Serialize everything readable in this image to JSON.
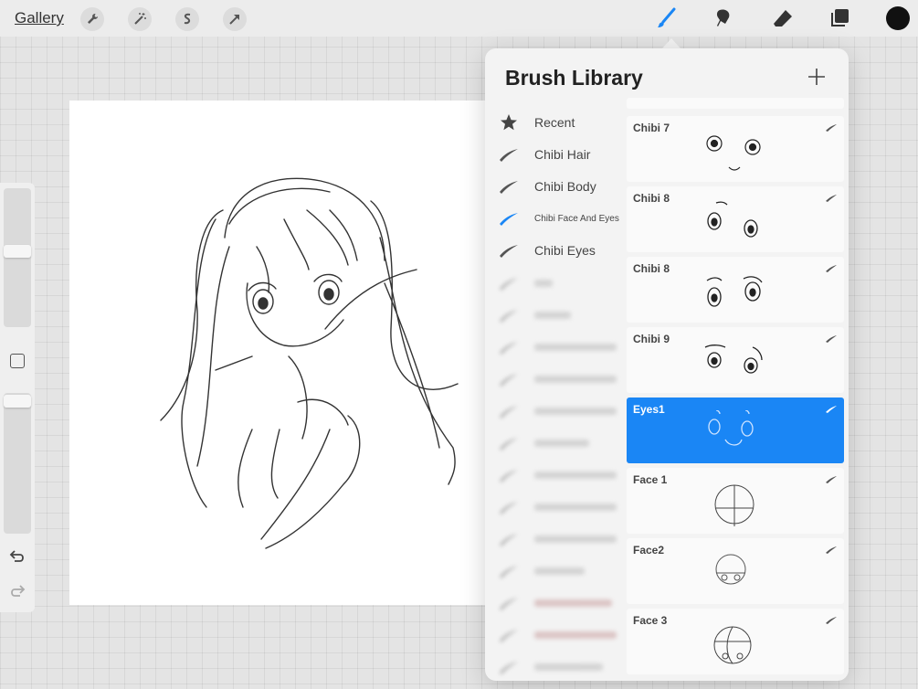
{
  "topbar": {
    "gallery_label": "Gallery",
    "left_tools": [
      "wrench-icon",
      "magic-wand-icon",
      "selection-icon",
      "transform-arrow-icon"
    ],
    "right_tools": [
      "brush-icon",
      "smudge-icon",
      "eraser-icon",
      "layers-icon"
    ],
    "active_tool": "brush-icon",
    "current_color": "#111111",
    "accent_color": "#1a86f5"
  },
  "sidebar": {
    "icons": [
      "brush-size-slider",
      "modify-square-icon",
      "opacity-slider",
      "undo-icon",
      "redo-icon"
    ]
  },
  "brush_library": {
    "title": "Brush Library",
    "add_icon": "plus-icon",
    "sets": [
      {
        "label": "Recent",
        "icon": "star-icon"
      },
      {
        "label": "Chibi Hair",
        "icon": "brush-stroke-icon"
      },
      {
        "label": "Chibi Body",
        "icon": "brush-stroke-icon"
      },
      {
        "label": "Chibi Face And Eyes",
        "icon": "brush-stroke-icon",
        "selected": true
      },
      {
        "label": "Chibi Eyes",
        "icon": "brush-stroke-icon"
      }
    ],
    "brushes": [
      {
        "name": "Chibi 7"
      },
      {
        "name": "Chibi 8"
      },
      {
        "name": "Chibi 8"
      },
      {
        "name": "Chibi 9"
      },
      {
        "name": "Eyes1",
        "selected": true
      },
      {
        "name": "Face 1"
      },
      {
        "name": "Face2"
      },
      {
        "name": "Face 3"
      }
    ]
  }
}
